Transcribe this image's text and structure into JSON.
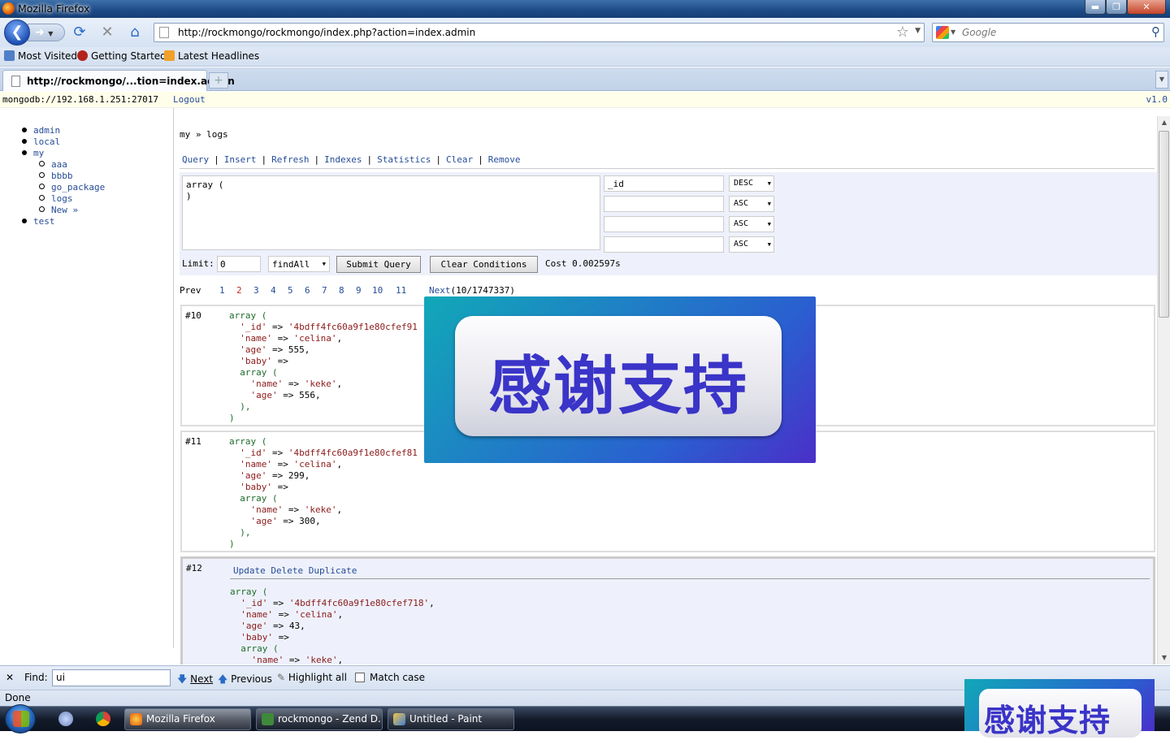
{
  "window": {
    "title": "Mozilla Firefox",
    "min": "▬",
    "max": "❐",
    "close": "✕"
  },
  "nav": {
    "url": "http://rockmongo/rockmongo/index.php?action=index.admin",
    "search_placeholder": "Google",
    "icons": [
      "back-icon",
      "forward-icon",
      "reload-icon",
      "stop-icon",
      "home-icon"
    ]
  },
  "bookmarks": [
    "Most Visited",
    "Getting Started",
    "Latest Headlines"
  ],
  "tab": {
    "title": "http://rockmongo/...tion=index.admin",
    "new_tab": "+"
  },
  "infobar": {
    "server": "mongodb://192.168.1.251:27017",
    "logout": "Logout",
    "version": "v1.0"
  },
  "sidebar": {
    "dbs": [
      {
        "name": "admin"
      },
      {
        "name": "local"
      },
      {
        "name": "my",
        "collections": [
          "aaa",
          "bbbb",
          "go_package",
          "logs",
          "New »"
        ]
      },
      {
        "name": "test"
      }
    ]
  },
  "main": {
    "breadcrumb": "my » logs",
    "ops": [
      "Query",
      "Insert",
      "Refresh",
      "Indexes",
      "Statistics",
      "Clear",
      "Remove"
    ],
    "criteria": "array (\n)",
    "sort_fields": [
      "_id",
      "",
      "",
      ""
    ],
    "sort_orders": [
      "DESC",
      "ASC",
      "ASC",
      "ASC"
    ],
    "limit_label": "Limit:",
    "limit_value": "0",
    "find_mode": "findAll",
    "submit_label": "Submit Query",
    "clear_label": "Clear Conditions",
    "cost": "Cost 0.002597s",
    "pager": {
      "prev": "Prev",
      "pages": [
        "1",
        "2",
        "3",
        "4",
        "5",
        "6",
        "7",
        "8",
        "9",
        "10",
        "11"
      ],
      "current": "2",
      "next": "Next",
      "total": "(10/1747337)"
    }
  },
  "records": [
    {
      "index": "#10",
      "id": "'4bdff4fc60a9f1e80cfef91",
      "name": "'celina'",
      "age": "555",
      "baby_name": "'keke'",
      "baby_age": "556"
    },
    {
      "index": "#11",
      "id": "'4bdff4fc60a9f1e80cfef81",
      "name": "'celina'",
      "age": "299",
      "baby_name": "'keke'",
      "baby_age": "300"
    },
    {
      "index": "#12",
      "id": "'4bdff4fc60a9f1e80cfef718'",
      "name": "'celina'",
      "age": "43",
      "baby_name": "'keke'",
      "actions": [
        "Update",
        "Delete",
        "Duplicate"
      ]
    }
  ],
  "overlay": {
    "text": "感谢支持"
  },
  "findbar": {
    "close": "✕",
    "label": "Find:",
    "value": "ui",
    "next": "Next",
    "previous": "Previous",
    "highlight": "Highlight all",
    "match_case": "Match case"
  },
  "status": {
    "text": "Done"
  },
  "taskbar": {
    "windows": [
      "Mozilla Firefox",
      "rockmongo - Zend D...",
      "Untitled - Paint"
    ],
    "active": "Mozilla Firefox"
  }
}
